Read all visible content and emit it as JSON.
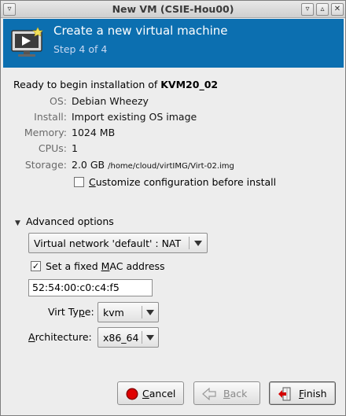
{
  "window": {
    "title": "New VM (CSIE-Hou00)",
    "wm_buttons": [
      "▿",
      "▵",
      "✕"
    ]
  },
  "banner": {
    "title": "Create a new virtual machine",
    "step": "Step 4 of 4",
    "color": "#0c6fb0"
  },
  "summary": {
    "ready_prefix": "Ready to begin installation of ",
    "vm_name": "KVM20_02",
    "rows": [
      {
        "label": "OS:",
        "value": "Debian Wheezy"
      },
      {
        "label": "Install:",
        "value": "Import existing OS image"
      },
      {
        "label": "Memory:",
        "value": "1024 MB"
      },
      {
        "label": "CPUs:",
        "value": "1"
      },
      {
        "label": "Storage:",
        "value": "2.0 GB",
        "extra": "/home/cloud/virtIMG/Virt-02.img"
      }
    ],
    "customize": {
      "label_mnemonic": "C",
      "label_rest": "ustomize configuration before install",
      "checked": false
    }
  },
  "advanced": {
    "label": "Advanced options",
    "expanded": true,
    "network": {
      "value": "Virtual network 'default' : NAT"
    },
    "fixed_mac": {
      "label_before": "Set a fixed ",
      "label_mnemonic": "M",
      "label_after": "AC address",
      "checked": true,
      "check_mark": "✓"
    },
    "mac_value": "52:54:00:c0:c4:f5",
    "virt_type": {
      "label_before": "Virt Ty",
      "label_mnemonic": "p",
      "label_after": "e:",
      "value": "kvm"
    },
    "architecture": {
      "label_mnemonic": "A",
      "label_rest": "rchitecture:",
      "value": "x86_64"
    }
  },
  "buttons": {
    "cancel": {
      "mnemonic": "C",
      "rest": "ancel",
      "icon": "stop-icon"
    },
    "back": {
      "mnemonic": "B",
      "rest": "ack",
      "icon": "back-arrow-icon",
      "enabled": false
    },
    "finish": {
      "mnemonic": "F",
      "rest": "inish",
      "icon": "finish-icon"
    }
  }
}
